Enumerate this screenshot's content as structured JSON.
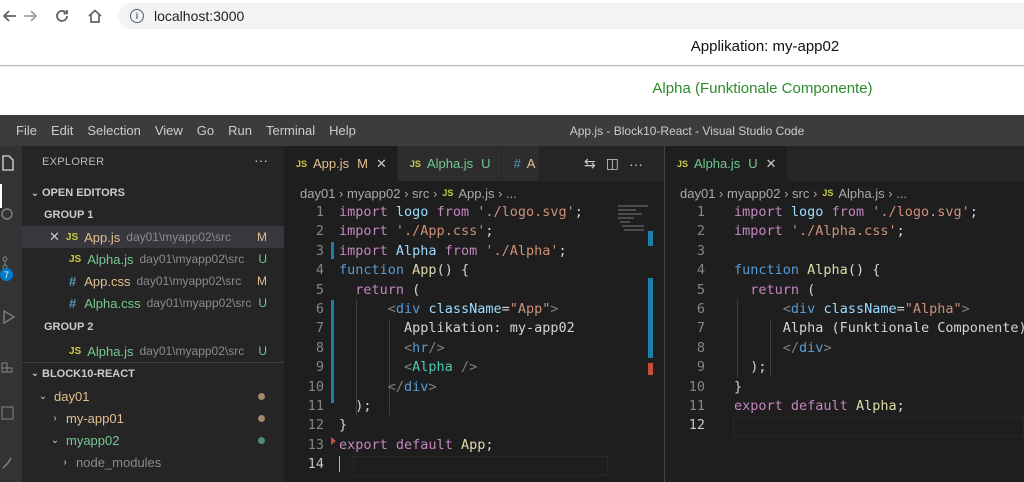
{
  "browser": {
    "url": "localhost:3000"
  },
  "app_page": {
    "heading": "Applikation: my-app02",
    "alpha_text": "Alpha (Funktionale Componente)"
  },
  "vscode": {
    "menu": [
      "File",
      "Edit",
      "Selection",
      "View",
      "Go",
      "Run",
      "Terminal",
      "Help"
    ],
    "window_title": "App.js - Block10-React - Visual Studio Code",
    "activity_badge": "7",
    "explorer": {
      "header": "EXPLORER",
      "more": "···",
      "open_editors_label": "OPEN EDITORS",
      "group1_label": "GROUP 1",
      "group2_label": "GROUP 2",
      "group1": [
        {
          "icon": "JS",
          "name": "App.js",
          "path": "day01\\myapp02\\src",
          "status": "M"
        },
        {
          "icon": "JS",
          "name": "Alpha.js",
          "path": "day01\\myapp02\\src",
          "status": "U"
        },
        {
          "icon": "#",
          "name": "App.css",
          "path": "day01\\myapp02\\src",
          "status": "M"
        },
        {
          "icon": "#",
          "name": "Alpha.css",
          "path": "day01\\myapp02\\src",
          "status": "U"
        }
      ],
      "group2": [
        {
          "icon": "JS",
          "name": "Alpha.js",
          "path": "day01\\myapp02\\src",
          "status": "U"
        }
      ],
      "workspace_label": "BLOCK10-REACT",
      "tree": [
        {
          "name": "day01"
        },
        {
          "name": "my-app01"
        },
        {
          "name": "myapp02"
        },
        {
          "name": "node_modules"
        }
      ]
    },
    "left_editor": {
      "tabs": [
        {
          "icon": "JS",
          "name": "App.js",
          "status": "M",
          "close": "✕"
        },
        {
          "icon": "JS",
          "name": "Alpha.js",
          "status": "U"
        },
        {
          "icon": "#",
          "name": "A"
        }
      ],
      "breadcrumb": [
        "day01",
        "myapp02",
        "src",
        "App.js",
        "..."
      ],
      "line_numbers": [
        "1",
        "2",
        "3",
        "4",
        "5",
        "6",
        "7",
        "8",
        "9",
        "10",
        "11",
        "12",
        "13",
        "14"
      ]
    },
    "right_editor": {
      "tabs": [
        {
          "icon": "JS",
          "name": "Alpha.js",
          "status": "U",
          "close": "✕"
        }
      ],
      "breadcrumb": [
        "day01",
        "myapp02",
        "src",
        "Alpha.js",
        "..."
      ],
      "line_numbers": [
        "1",
        "2",
        "3",
        "4",
        "5",
        "6",
        "7",
        "8",
        "9",
        "10",
        "11",
        "12"
      ]
    },
    "colors": {
      "modified": "#e2c08d",
      "untracked": "#73c991",
      "accent": "#007acc"
    }
  }
}
